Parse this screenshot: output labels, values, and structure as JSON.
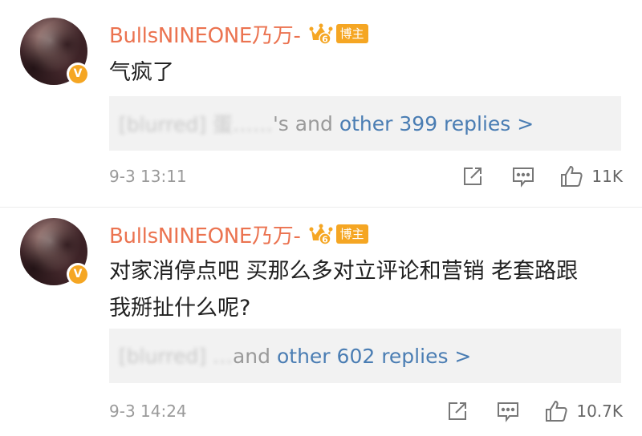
{
  "comments": [
    {
      "user": {
        "name": "BullsNINEONE乃万-",
        "badge": "博主",
        "crown_level": "6"
      },
      "text": "气疯了",
      "replies": {
        "blurred_preview": "[blurred] 蛋……",
        "tail": "'s and",
        "link": "other 399 replies >"
      },
      "time": "9-3 13:11",
      "likes": "11K"
    },
    {
      "user": {
        "name": "BullsNINEONE乃万-",
        "badge": "博主",
        "crown_level": "6"
      },
      "text_line1": "对家消停点吧 买那么多对立评论和营销 老套路跟",
      "text_line2": "我掰扯什么呢?",
      "replies": {
        "blurred_preview": "[blurred] …",
        "tail": "a",
        "link_prefix": "nd",
        "link": "other 602 replies >"
      },
      "time": "9-3 14:24",
      "likes": "10.7K"
    }
  ],
  "icons": {
    "verified": "V",
    "share": "share-icon",
    "comment": "comment-icon",
    "like": "like-icon",
    "crown": "crown-icon"
  },
  "colors": {
    "username": "#eb7350",
    "link": "#4a7db3",
    "badge": "#f5a623",
    "reply_bg": "#f2f2f2"
  }
}
